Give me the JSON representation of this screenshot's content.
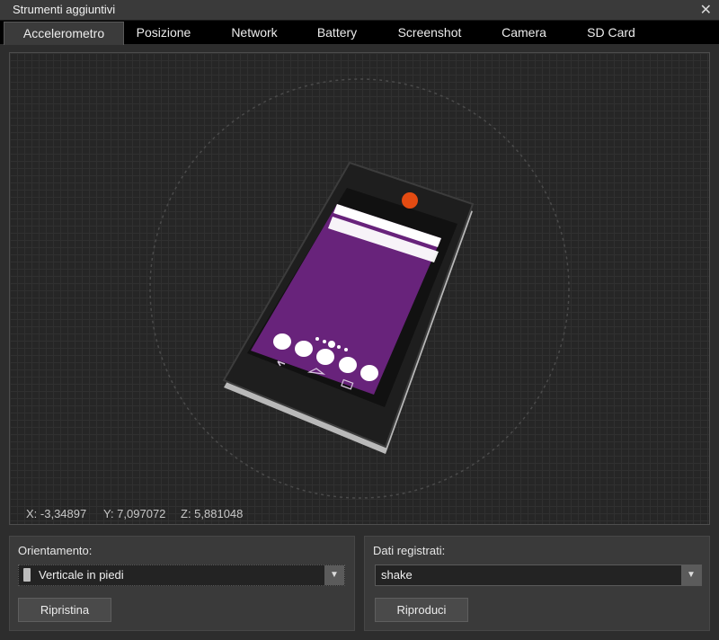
{
  "window": {
    "title": "Strumenti aggiuntivi"
  },
  "tabs": [
    {
      "label": "Accelerometro",
      "active": true
    },
    {
      "label": "Posizione"
    },
    {
      "label": "Network"
    },
    {
      "label": "Battery"
    },
    {
      "label": "Screenshot"
    },
    {
      "label": "Camera"
    },
    {
      "label": "SD Card"
    }
  ],
  "readout": {
    "x": "X: -3,34897",
    "y": "Y: 7,097072",
    "z": "Z: 5,881048"
  },
  "orientation_panel": {
    "label": "Orientamento:",
    "selected": "Verticale in piedi",
    "reset_button": "Ripristina"
  },
  "recorded_panel": {
    "label": "Dati registrati:",
    "selected": "shake",
    "play_button": "Riproduci"
  },
  "colors": {
    "screen_purple": "#68237b",
    "camera_orange": "#e34b12",
    "accent_active_tab": "#3b3b3b"
  }
}
